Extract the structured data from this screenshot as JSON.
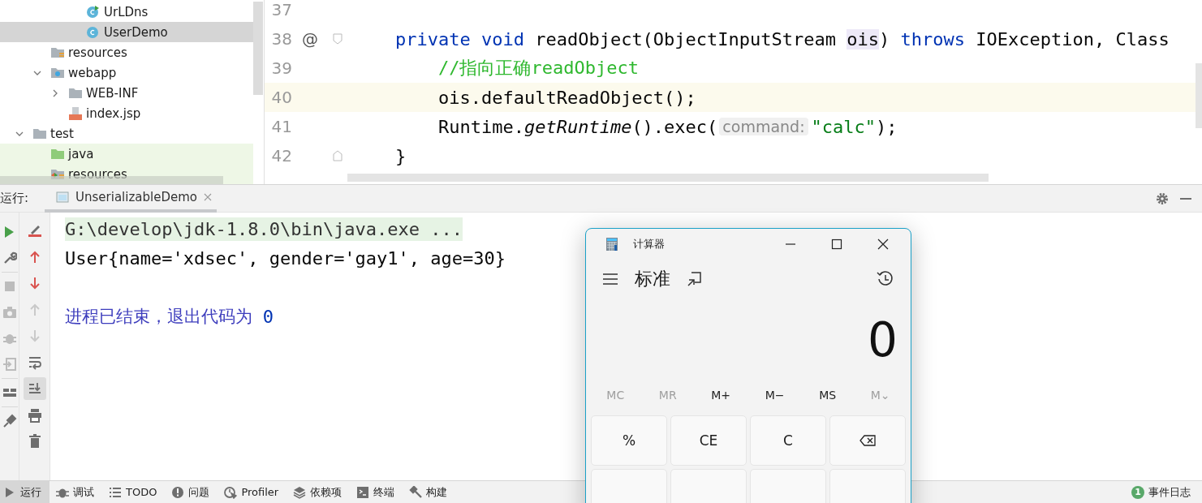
{
  "project_tree": {
    "items": [
      {
        "children": [
          {
            "children": [
              {
                "children": [
                  {
                    "label": "UrLDns",
                    "kind": "class-run",
                    "selected": false
                  },
                  {
                    "label": "UserDemo",
                    "kind": "class",
                    "selected": true
                  }
                ]
              }
            ]
          },
          {
            "label": "resources",
            "kind": "resources",
            "selected": false
          },
          {
            "label": "webapp",
            "kind": "web",
            "expanded": true,
            "selected": false,
            "children": [
              {
                "label": "WEB-INF",
                "kind": "folder",
                "expanded": false,
                "selected": false
              },
              {
                "label": "index.jsp",
                "kind": "jsp",
                "selected": false
              }
            ]
          }
        ]
      },
      {
        "label": "test",
        "kind": "folder",
        "expanded": true,
        "selected": false,
        "children": [
          {
            "label": "java",
            "kind": "test-sources",
            "selected": false
          },
          {
            "label": "resources",
            "kind": "test-resources",
            "selected": false
          }
        ]
      }
    ]
  },
  "editor": {
    "lines": [
      {
        "number": "37",
        "fold_start": false,
        "fold_end": false
      },
      {
        "number": "38",
        "marker": "@",
        "fold_start": true,
        "fold_end": false,
        "tokens": [
          {
            "kind": "keyword",
            "text": "    private void "
          },
          {
            "kind": "plain",
            "text": "readObject(ObjectInputStream "
          },
          {
            "kind": "param",
            "text": "ois"
          },
          {
            "kind": "plain",
            "text": ") "
          },
          {
            "kind": "keyword",
            "text": "throws "
          },
          {
            "kind": "plain",
            "text": "IOException, Class"
          }
        ]
      },
      {
        "number": "39",
        "fold_start": false,
        "fold_end": false,
        "tokens": [
          {
            "kind": "comment",
            "text": "        //指向正确readObject"
          }
        ]
      },
      {
        "number": "40",
        "current": true,
        "fold_start": false,
        "fold_end": false,
        "tokens": [
          {
            "kind": "plain",
            "text": "        ois.defaultReadObject();"
          }
        ]
      },
      {
        "number": "41",
        "fold_start": false,
        "fold_end": false,
        "tokens": [
          {
            "kind": "plain",
            "text": "        Runtime."
          },
          {
            "kind": "italic",
            "text": "getRuntime"
          },
          {
            "kind": "plain",
            "text": "().exec("
          },
          {
            "kind": "hint",
            "text": "command:"
          },
          {
            "kind": "string",
            "text": "\"calc\""
          },
          {
            "kind": "plain",
            "text": ");"
          }
        ]
      },
      {
        "number": "42",
        "fold_start": false,
        "fold_end": true,
        "tokens": [
          {
            "kind": "plain",
            "text": "    }"
          }
        ]
      }
    ]
  },
  "run_panel": {
    "label": "运行:",
    "tabs": [
      {
        "label": "UnserializableDemo",
        "selected": true
      }
    ],
    "toolbar_left": [
      {
        "kind": "run",
        "disabled": false
      },
      {
        "kind": "wrench",
        "disabled": false
      },
      {
        "kind": "stop",
        "disabled": true
      },
      {
        "kind": "camera",
        "disabled": true
      },
      {
        "kind": "bug",
        "disabled": true
      },
      {
        "kind": "exit",
        "disabled": true
      },
      {
        "kind": "layout",
        "disabled": false
      },
      {
        "kind": "pin",
        "disabled": false
      }
    ],
    "toolbar_right": [
      {
        "kind": "clear",
        "selected": false
      },
      {
        "kind": "up-red",
        "selected": false
      },
      {
        "kind": "down-red",
        "selected": false
      },
      {
        "kind": "up-grey",
        "selected": false
      },
      {
        "kind": "down-grey",
        "selected": false
      },
      {
        "kind": "wrap",
        "selected": false
      },
      {
        "kind": "scroll-end",
        "selected": true
      },
      {
        "kind": "print",
        "selected": false
      },
      {
        "kind": "trash",
        "selected": false
      }
    ],
    "console": [
      {
        "kind": "command",
        "text": "G:\\develop\\jdk-1.8.0\\bin\\java.exe ..."
      },
      {
        "kind": "output",
        "text": "User{name='xdsec', gender='gay1', age=30}"
      },
      {
        "kind": "blank"
      },
      {
        "kind": "exit",
        "text": "进程已结束，退出代码为 ",
        "code": "0"
      }
    ]
  },
  "status_bar": {
    "items": [
      {
        "label": "运行",
        "kind": "run",
        "selected": true
      },
      {
        "label": "调试",
        "kind": "bug",
        "selected": false
      },
      {
        "label": "TODO",
        "kind": "list",
        "selected": false
      },
      {
        "label": "问题",
        "kind": "problem",
        "selected": false
      },
      {
        "label": "Profiler",
        "kind": "profiler",
        "selected": false
      },
      {
        "label": "依赖项",
        "kind": "layers",
        "selected": false
      },
      {
        "label": "终端",
        "kind": "terminal",
        "selected": false
      },
      {
        "label": "构建",
        "kind": "hammer",
        "selected": false
      }
    ],
    "event_log": {
      "count": "1",
      "label": "事件日志"
    }
  },
  "calculator": {
    "title": "计算器",
    "mode": "标准",
    "display": "0",
    "memory": [
      {
        "label": "MC",
        "disabled": true
      },
      {
        "label": "MR",
        "disabled": true
      },
      {
        "label": "M+",
        "disabled": false
      },
      {
        "label": "M−",
        "disabled": false
      },
      {
        "label": "MS",
        "disabled": false
      },
      {
        "label": "M⌄",
        "disabled": true
      }
    ],
    "keys": [
      {
        "kind": "text",
        "label": "%"
      },
      {
        "kind": "text",
        "label": "CE"
      },
      {
        "kind": "text",
        "label": "C"
      },
      {
        "kind": "backspace"
      }
    ]
  }
}
